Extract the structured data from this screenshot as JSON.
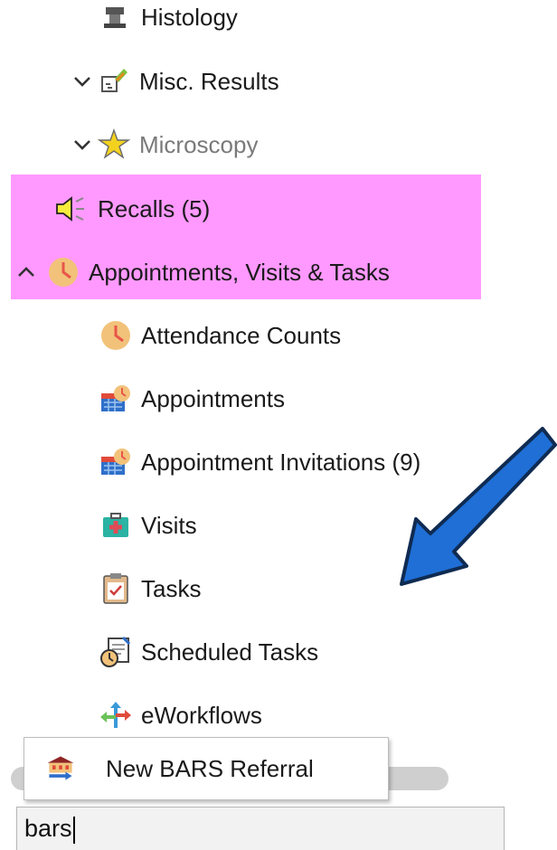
{
  "tree": {
    "histology": {
      "label": "Histology",
      "icon": "histology-icon"
    },
    "misc_results": {
      "label": "Misc. Results",
      "icon": "misc-results-icon",
      "expander": "chevron-down"
    },
    "microscopy": {
      "label": "Microscopy",
      "icon": "microscopy-star-icon",
      "expander": "chevron-down"
    },
    "recalls": {
      "label": "Recalls (5)",
      "icon": "speaker-icon"
    },
    "appointments_group": {
      "label": "Appointments, Visits & Tasks",
      "icon": "clock-icon",
      "expander": "chevron-up"
    },
    "children": [
      {
        "label": "Attendance Counts",
        "icon": "clock-icon"
      },
      {
        "label": "Appointments",
        "icon": "calendar-clock-icon"
      },
      {
        "label": "Appointment Invitations (9)",
        "icon": "calendar-clock-icon"
      },
      {
        "label": "Visits",
        "icon": "medical-kit-icon"
      },
      {
        "label": "Tasks",
        "icon": "clipboard-check-icon"
      },
      {
        "label": "Scheduled Tasks",
        "icon": "scheduled-task-icon"
      },
      {
        "label": "eWorkflows",
        "icon": "workflow-arrows-icon"
      }
    ]
  },
  "popup": {
    "label": "New BARS Referral",
    "icon": "referral-building-icon"
  },
  "search": {
    "value": "bars"
  },
  "colors": {
    "highlight": "#ff99ff",
    "arrow_fill": "#1f6fd6",
    "arrow_stroke": "#0f2b52",
    "clock": "#f2c27a",
    "clock_hand": "#e8564a"
  }
}
